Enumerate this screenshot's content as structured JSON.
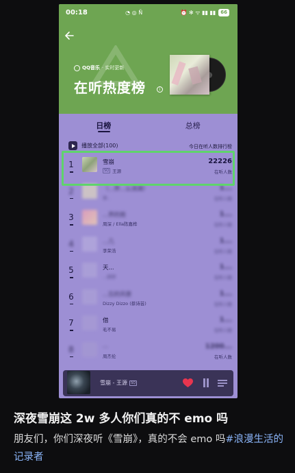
{
  "status_bar": {
    "time": "00:18",
    "left_icons": "◔ ◎ Ñ",
    "right_icons": "⏰ ✻ ᯤ ▮▮ ▮▮",
    "battery": "66"
  },
  "header": {
    "brand": "QQ音乐",
    "brand_sub": "· 实时更新",
    "title": "在听热度榜"
  },
  "tabs": [
    {
      "label": "日榜",
      "active": true
    },
    {
      "label": "总榜",
      "active": false
    }
  ],
  "play_all_label": "播放全部(100)",
  "rank_note": "今日在听人数排行榜",
  "songs": [
    {
      "rank": "1",
      "title": "雪崩",
      "artist": "王源",
      "badge": "SQ",
      "count": "22226",
      "count_label": "在听人数",
      "blurred": false
    },
    {
      "rank": "2",
      "title": "（...界...么淌满）",
      "artist": "李..",
      "badge": "",
      "count": "1...",
      "count_label": "在听人数",
      "blurred": true
    },
    {
      "rank": "3",
      "title": "...界的雨",
      "artist": "周深 / Ella陈嘉桦",
      "badge": "",
      "count": "1...",
      "count_label": "在听人数",
      "blurred": true
    },
    {
      "rank": "4",
      "title": "...几",
      "artist": "李荣浩",
      "badge": "",
      "count": "1...",
      "count_label": "在听人数",
      "blurred": true
    },
    {
      "rank": "5",
      "title": "天...",
      "artist": "...舒妤",
      "badge": "",
      "count": "1...",
      "count_label": "在听人数",
      "blurred": true
    },
    {
      "rank": "6",
      "title": "...忘的风景",
      "artist": "Dizzy Dizzo (蔡诗芸)",
      "badge": "",
      "count": "1...",
      "count_label": "在听人数",
      "blurred": true
    },
    {
      "rank": "7",
      "title": "借",
      "artist": "毛不易",
      "badge": "",
      "count": "1...",
      "count_label": "在听人数",
      "blurred": true
    },
    {
      "rank": "8",
      "title": "...",
      "artist": "周杰伦",
      "badge": "",
      "count": "1200...",
      "count_label": "在听人数",
      "blurred": true
    }
  ],
  "mini_player": {
    "title": "雪崩 - 王源",
    "badge": "SQ"
  },
  "post": {
    "title": "深夜雪崩这 2w 多人你们真的不 emo 吗",
    "body": "朋友们，你们深夜听《雪崩》，真的不会 emo 吗",
    "hashtag": "#浪漫生活的记录者"
  },
  "colors": {
    "header_green": "#6ea552",
    "list_purple": "#9d8fd4",
    "highlight_green": "#5fd46b",
    "heart_red": "#e8354f"
  }
}
